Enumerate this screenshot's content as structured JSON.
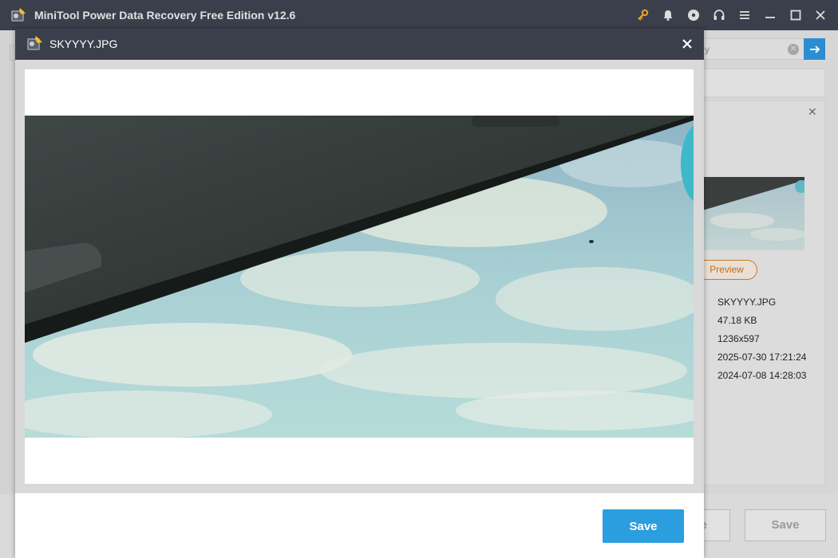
{
  "app": {
    "title": "MiniTool Power Data Recovery Free Edition v12.6"
  },
  "titlebar_icons": [
    "key-icon",
    "bell-icon",
    "disc-icon",
    "headset-icon",
    "menu-icon",
    "minimize-icon",
    "maximize-icon",
    "close-icon"
  ],
  "background": {
    "search_partial": "y",
    "preview_button": "Preview",
    "file_info": {
      "name": "SKYYYY.JPG",
      "size": "47.18 KB",
      "dimensions": "1236x597",
      "date1": "2025-07-30 17:21:24",
      "date2": "2024-07-08 14:28:03",
      "colon1": ":",
      "colon2": ":"
    },
    "bottom_buttons": {
      "partial_label": "e",
      "save_label": "Save"
    }
  },
  "dialog": {
    "title": "SKYYYY.JPG",
    "save_label": "Save"
  },
  "colors": {
    "titlebar": "#3b3f4b",
    "accent": "#2b9ee0",
    "preview_orange": "#c46a18"
  }
}
